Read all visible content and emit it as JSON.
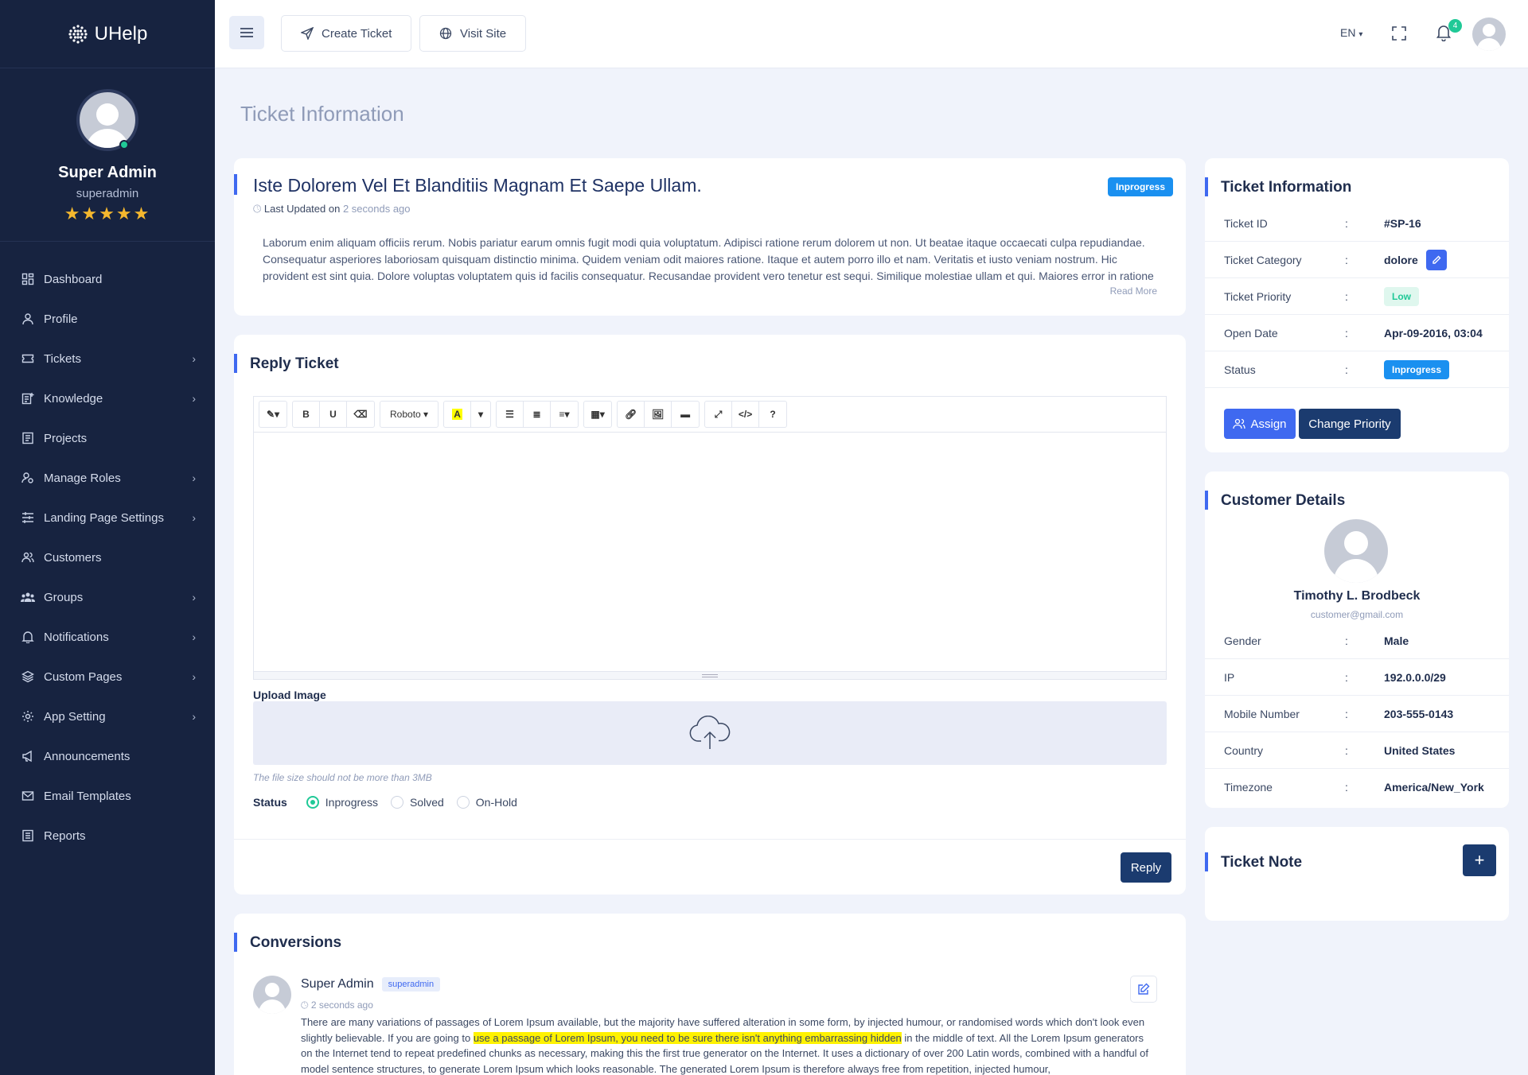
{
  "app": {
    "brand": "UHelp"
  },
  "sidebar": {
    "profile": {
      "name": "Super Admin",
      "username": "superadmin",
      "rating_stars": 5,
      "stars_text": "★★★★★"
    },
    "items": [
      {
        "label": "Dashboard",
        "icon": "dashboard-icon",
        "has_children": false
      },
      {
        "label": "Profile",
        "icon": "user-icon",
        "has_children": false
      },
      {
        "label": "Tickets",
        "icon": "ticket-icon",
        "has_children": true
      },
      {
        "label": "Knowledge",
        "icon": "knowledge-icon",
        "has_children": true
      },
      {
        "label": "Projects",
        "icon": "projects-icon",
        "has_children": false
      },
      {
        "label": "Manage Roles",
        "icon": "roles-icon",
        "has_children": true
      },
      {
        "label": "Landing Page Settings",
        "icon": "sliders-icon",
        "has_children": true
      },
      {
        "label": "Customers",
        "icon": "customers-icon",
        "has_children": false
      },
      {
        "label": "Groups",
        "icon": "groups-icon",
        "has_children": true
      },
      {
        "label": "Notifications",
        "icon": "bell-icon",
        "has_children": true
      },
      {
        "label": "Custom Pages",
        "icon": "layers-icon",
        "has_children": true
      },
      {
        "label": "App Setting",
        "icon": "gear-icon",
        "has_children": true
      },
      {
        "label": "Announcements",
        "icon": "megaphone-icon",
        "has_children": false
      },
      {
        "label": "Email Templates",
        "icon": "mail-icon",
        "has_children": false
      },
      {
        "label": "Reports",
        "icon": "report-icon",
        "has_children": false
      }
    ]
  },
  "topbar": {
    "create_ticket": "Create Ticket",
    "visit_site": "Visit Site",
    "language": "EN",
    "notification_count": "4"
  },
  "page": {
    "title": "Ticket Information"
  },
  "ticket": {
    "title": "Iste Dolorem Vel Et Blanditiis Magnam Et Saepe Ullam.",
    "status_badge": "Inprogress",
    "last_updated_label": "Last Updated on",
    "last_updated_value": "2 seconds ago",
    "description": "Laborum enim aliquam officiis rerum. Nobis pariatur earum omnis fugit modi quia voluptatum. Adipisci ratione rerum dolorem ut non. Ut beatae itaque occaecati culpa repudiandae. Consequatur asperiores laboriosam quisquam distinctio minima. Quidem veniam odit maiores ratione. Itaque et autem porro illo et nam. Veritatis et iusto veniam nostrum. Hic provident est sint quia. Dolore voluptas voluptatem quis id facilis consequatur. Recusandae provident vero tenetur est sequi. Similique molestiae ullam et qui. Maiores error in ratione",
    "read_more": "Read More"
  },
  "reply": {
    "title": "Reply Ticket",
    "toolbar": {
      "font": "Roboto",
      "bold": "B",
      "underline": "U",
      "help": "?"
    },
    "upload_label": "Upload Image",
    "upload_hint": "The file size should not be more than 3MB",
    "status_label": "Status",
    "status_options": [
      "Inprogress",
      "Solved",
      "On-Hold"
    ],
    "status_selected": "Inprogress",
    "reply_button": "Reply"
  },
  "conversations": {
    "title": "Conversions",
    "items": [
      {
        "author": "Super Admin",
        "role": "superadmin",
        "time": "2 seconds ago",
        "text_before": "There are many variations of passages of Lorem Ipsum available, but the majority have suffered alteration in some form, by injected humour, or randomised words which don't look even slightly believable. If you are going to ",
        "text_highlight": "use a passage of Lorem Ipsum, you need to be sure there isn't anything embarrassing hidden",
        "text_after": " in the middle of text. All the Lorem Ipsum generators on the Internet tend to repeat predefined chunks as necessary, making this the first true generator on the Internet. It uses a dictionary of over 200 Latin words, combined with a handful of model sentence structures, to generate Lorem Ipsum which looks reasonable. The generated Lorem Ipsum is therefore always free from repetition, injected humour,"
      }
    ]
  },
  "ticket_info": {
    "title": "Ticket Information",
    "rows": [
      {
        "key": "Ticket ID",
        "value": "#SP-16"
      },
      {
        "key": "Ticket Category",
        "value": "dolore"
      },
      {
        "key": "Ticket Priority",
        "value": "Low"
      },
      {
        "key": "Open Date",
        "value": "Apr-09-2016, 03:04"
      },
      {
        "key": "Status",
        "value": "Inprogress"
      }
    ],
    "separator": ":",
    "assign_button": "Assign",
    "change_priority_button": "Change Priority"
  },
  "customer": {
    "title": "Customer Details",
    "name": "Timothy L. Brodbeck",
    "email": "customer@gmail.com",
    "rows": [
      {
        "key": "Gender",
        "value": "Male"
      },
      {
        "key": "IP",
        "value": "192.0.0.0/29"
      },
      {
        "key": "Mobile Number",
        "value": "203-555-0143"
      },
      {
        "key": "Country",
        "value": "United States"
      },
      {
        "key": "Timezone",
        "value": "America/New_York"
      }
    ]
  },
  "ticket_note": {
    "title": "Ticket Note",
    "add_label": "+"
  },
  "colors": {
    "sidebar_bg": "#172340",
    "accent": "#3f69f0",
    "primary_dark": "#1b3b6f",
    "success": "#20c997",
    "info_badge": "#1a90f0"
  }
}
